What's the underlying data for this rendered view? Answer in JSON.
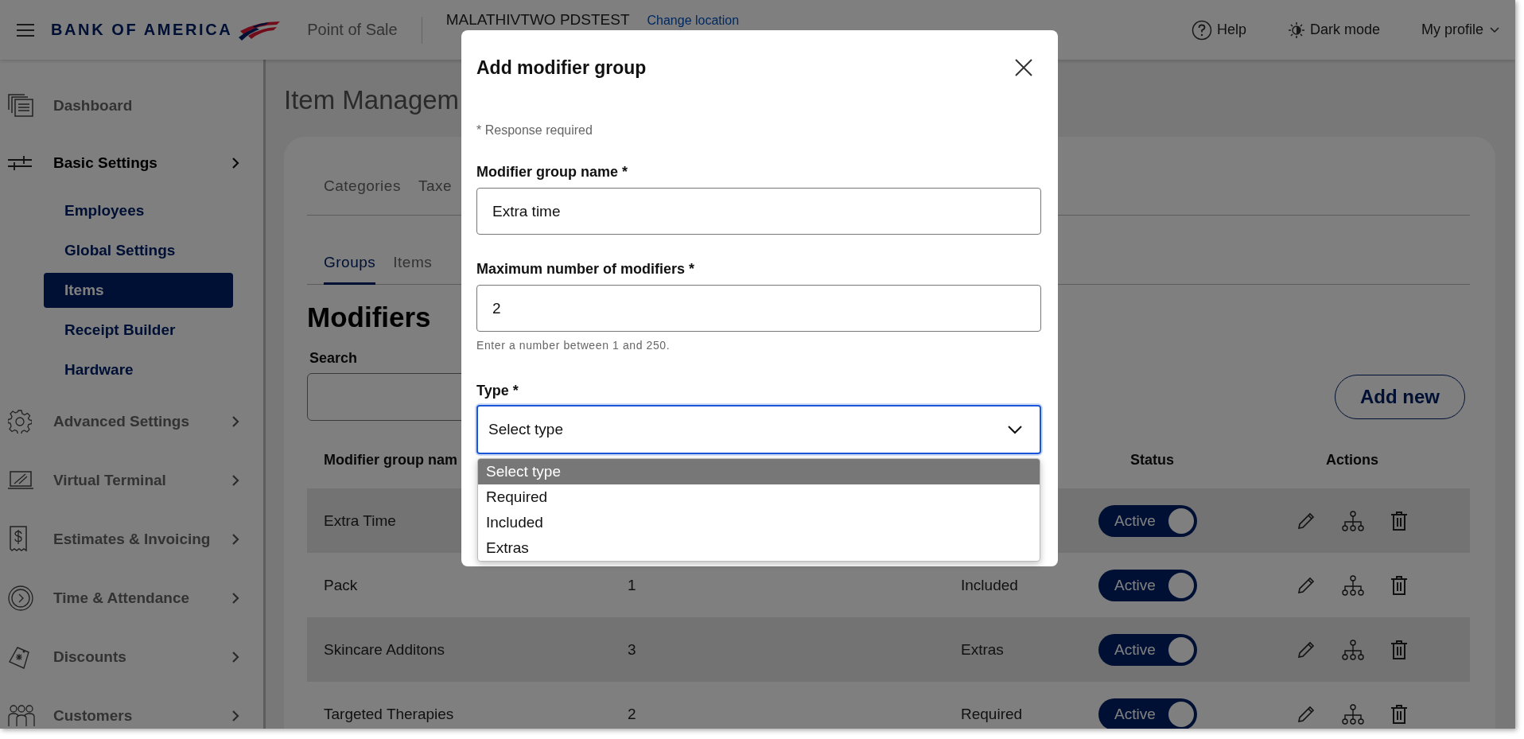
{
  "header": {
    "brand": "BANK OF AMERICA",
    "app_name": "Point of Sale",
    "location": "MALATHIVTWO PDSTEST",
    "change_location": "Change location",
    "help": "Help",
    "dark_mode": "Dark mode",
    "profile": "My profile"
  },
  "sidebar": {
    "items": [
      {
        "label": "Dashboard"
      },
      {
        "label": "Basic Settings",
        "expanded": true,
        "children": [
          {
            "label": "Employees",
            "selected": false
          },
          {
            "label": "Global Settings",
            "selected": false
          },
          {
            "label": "Items",
            "selected": true
          },
          {
            "label": "Receipt Builder",
            "selected": false
          },
          {
            "label": "Hardware",
            "selected": false
          }
        ]
      },
      {
        "label": "Advanced Settings",
        "expanded": false
      },
      {
        "label": "Virtual Terminal",
        "expanded": false
      },
      {
        "label": "Estimates & Invoicing",
        "expanded": false
      },
      {
        "label": "Time & Attendance",
        "expanded": false
      },
      {
        "label": "Discounts",
        "expanded": false
      },
      {
        "label": "Customers",
        "expanded": false
      }
    ]
  },
  "main": {
    "title": "Item Managem",
    "tabs": [
      {
        "label": "Categories",
        "selected": false
      },
      {
        "label": "Taxe",
        "selected": false
      }
    ],
    "subtabs": [
      {
        "label": "Groups",
        "selected": true
      },
      {
        "label": "Items",
        "selected": false
      }
    ],
    "heading": "Modifiers",
    "search": {
      "label": "Search"
    },
    "add_button": "Add new",
    "table": {
      "header": {
        "name": "Modifier group nam",
        "status": "Status",
        "actions": "Actions"
      },
      "rows": [
        {
          "name": "Extra Time",
          "status": "Active",
          "on": true
        },
        {
          "name": "Pack",
          "max": "1",
          "type": "Included",
          "status": "Active",
          "on": true
        },
        {
          "name": "Skincare Additons",
          "max": "3",
          "type": "Extras",
          "status": "Active",
          "on": true
        },
        {
          "name": "Targeted Therapies",
          "max": "2",
          "type": "Required",
          "status": "Active",
          "on": true
        }
      ]
    }
  },
  "modal": {
    "title": "Add modifier group",
    "note": "* Response required",
    "fields": [
      {
        "label": "Modifier group name *",
        "value": "Extra time"
      },
      {
        "label": "Maximum number of modifiers *",
        "value": "2",
        "hint": "Enter a number between 1 and 250."
      }
    ],
    "select": {
      "label": "Type *",
      "value": "Select type",
      "open": true,
      "options": [
        {
          "label": "Select type",
          "selected": true
        },
        {
          "label": "Required",
          "selected": false
        },
        {
          "label": "Included",
          "selected": false
        },
        {
          "label": "Extras",
          "selected": false
        }
      ]
    }
  }
}
